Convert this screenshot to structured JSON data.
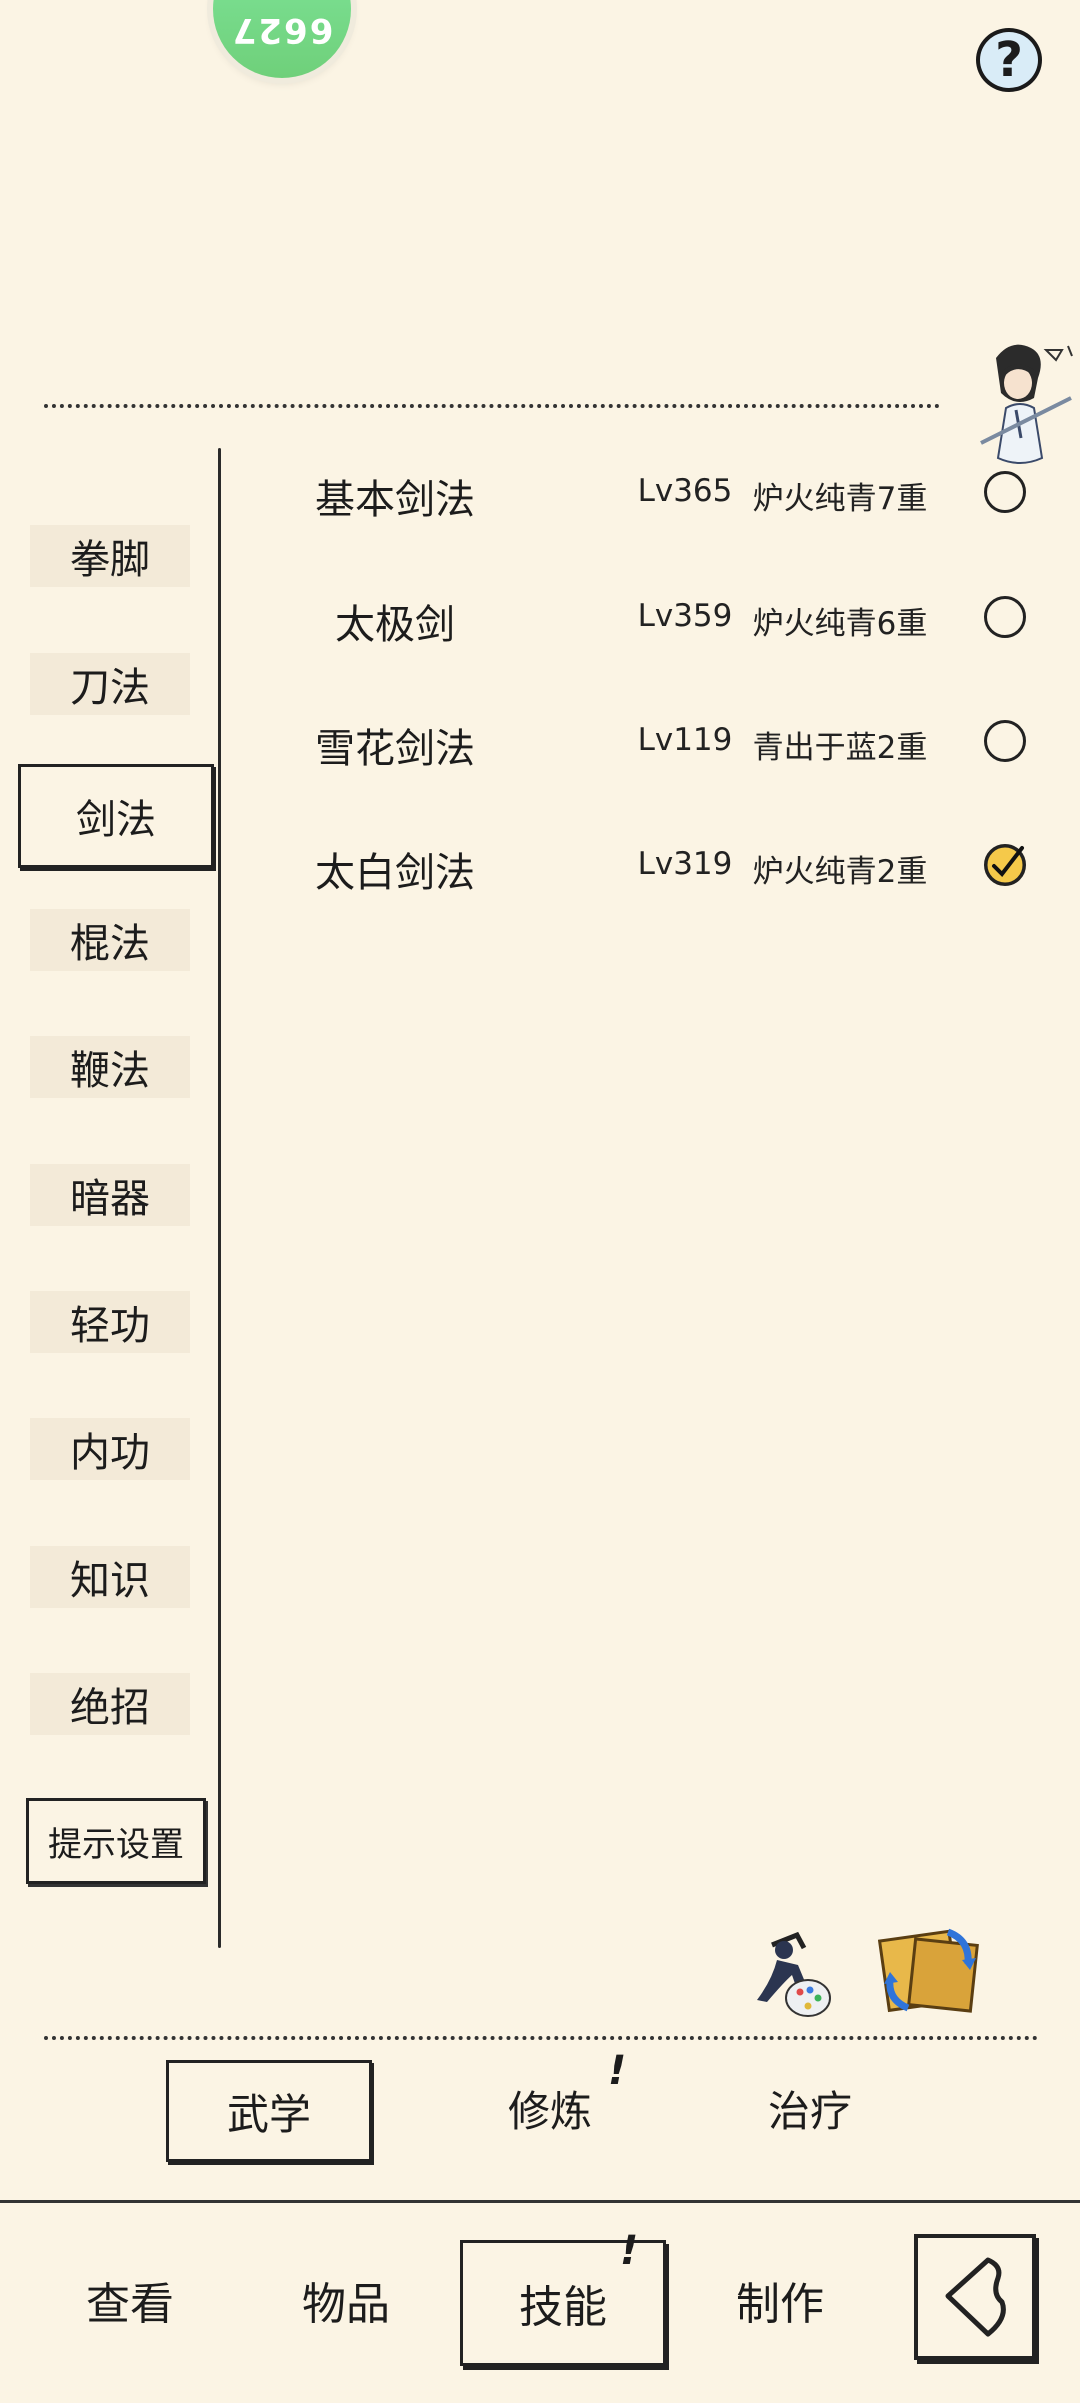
{
  "header": {
    "avatar_number": "6627",
    "help_label": "?"
  },
  "categories": [
    {
      "label": "拳脚"
    },
    {
      "label": "刀法"
    },
    {
      "label": "剑法",
      "active": true
    },
    {
      "label": "棍法"
    },
    {
      "label": "鞭法"
    },
    {
      "label": "暗器"
    },
    {
      "label": "轻功"
    },
    {
      "label": "内功"
    },
    {
      "label": "知识"
    },
    {
      "label": "绝招"
    }
  ],
  "hint_settings_label": "提示设置",
  "skills": [
    {
      "name": "基本剑法",
      "level": "Lv365",
      "realm": "炉火纯青7重",
      "selected": false
    },
    {
      "name": "太极剑",
      "level": "Lv359",
      "realm": "炉火纯青6重",
      "selected": false
    },
    {
      "name": "雪花剑法",
      "level": "Lv119",
      "realm": "青出于蓝2重",
      "selected": false
    },
    {
      "name": "太白剑法",
      "level": "Lv319",
      "realm": "炉火纯青2重",
      "selected": true
    }
  ],
  "sub_tabs": [
    {
      "label": "武学",
      "active": true
    },
    {
      "label": "修炼",
      "badge": "!"
    },
    {
      "label": "治疗"
    }
  ],
  "bottom_nav": [
    {
      "label": "查看"
    },
    {
      "label": "物品"
    },
    {
      "label": "技能",
      "active": true,
      "badge": "!"
    },
    {
      "label": "制作"
    }
  ],
  "icons": {
    "help": "question-mark-icon",
    "character": "swordsman-character-icon",
    "palette": "martial-artist-palette-icon",
    "swap": "scroll-swap-icon",
    "back": "back-arrow-icon"
  }
}
